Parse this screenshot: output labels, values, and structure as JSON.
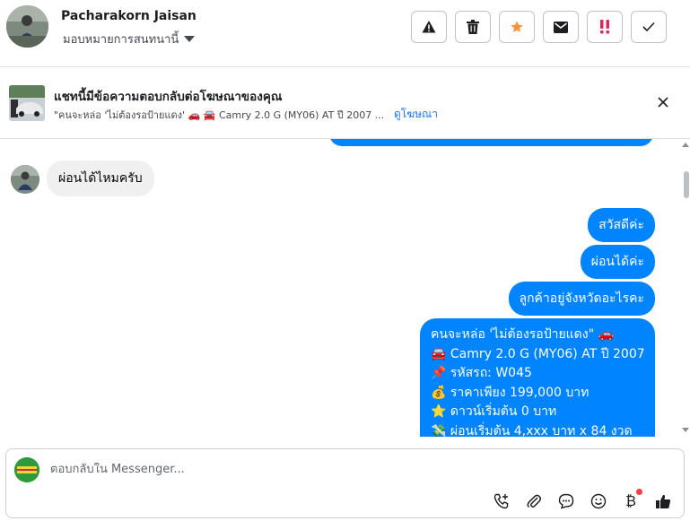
{
  "header": {
    "contact_name": "Pacharakorn Jaisan",
    "assign_label": "มอบหมายการสนทนานี้",
    "toolbar": [
      {
        "icon": "warning-icon",
        "color": "#1c1e21"
      },
      {
        "icon": "trash-icon",
        "color": "#1c1e21"
      },
      {
        "icon": "star-icon",
        "color": "#f7923a"
      },
      {
        "icon": "mail-icon",
        "color": "#1c1e21"
      },
      {
        "icon": "double-exclamation-icon",
        "color": "#e0245e"
      },
      {
        "icon": "check-icon",
        "color": "#1c1e21"
      }
    ]
  },
  "ad_banner": {
    "title": "แชทนี้มีข้อความตอบกลับต่อโฆษณาของคุณ",
    "snippet": "\"คนจะหล่อ 'ไม่ต้องรอป้ายแดง' 🚗 🚘 Camry 2.0 G (MY06) AT ปี 2007 ...",
    "link": "ดูโฆษณา",
    "close_icon": "close-icon"
  },
  "messages": {
    "incoming": {
      "text": "ผ่อนได้ไหมครับ"
    },
    "outgoing_short": [
      {
        "text": "สวัสดีค่ะ"
      },
      {
        "text": "ผ่อนได้ค่ะ"
      },
      {
        "text": "ลูกค้าอยู่จังหวัดอะไรคะ"
      }
    ],
    "outgoing_long": [
      "คนจะหล่อ 'ไม่ต้องรอป้ายแดง\" 🚗",
      "🚘 Camry 2.0 G (MY06) AT ปี 2007",
      "📌 รหัสรถ: W045",
      "💰 ราคาเพียง 199,000 บาท",
      "⭐ ดาวน์เริ่มต้น 0 บาท",
      "💸 ผ่อนเริ่มต้น 4,xxx บาท x 84 งวด"
    ]
  },
  "composer": {
    "placeholder": "ตอบกลับใน Messenger...",
    "tools": [
      "phone-add-icon",
      "attachment-icon",
      "saved-reply-icon",
      "emoji-icon",
      "bitcoin-icon",
      "thumbs-up-icon"
    ]
  },
  "colors": {
    "outgoing_bubble": "#0084ff",
    "incoming_bubble": "#f0f0f0",
    "link": "#1877f2"
  }
}
